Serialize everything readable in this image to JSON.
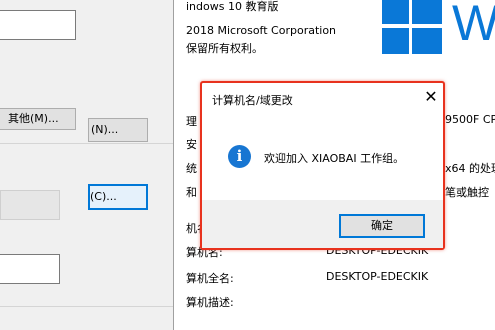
{
  "left_panel": {
    "other_button": "其他(M)...",
    "change_button_partial": "(N)...",
    "change_c_button_partial": "(C)..."
  },
  "system_info": {
    "edition_partial": "indows 10 教育版",
    "copyright": "2018 Microsoft Corporation",
    "rights": "保留所有权利。",
    "logo_letter": "W",
    "processor_label_partial": "理",
    "processor_value_partial": "9500F CP",
    "installed_label_partial": "安",
    "system_type_label_partial": "统",
    "system_type_value_partial": "x64 的处理",
    "pen_label_partial": "和",
    "pen_value_partial": "笔或触控",
    "computer_name_section_partial": "机名",
    "computer_name_label": "算机名:",
    "computer_name_value": "DESKTOP-EDECKIK",
    "full_name_label": "算机全名:",
    "full_name_value": "DESKTOP-EDECKIK",
    "description_label": "算机描述:"
  },
  "dialog": {
    "title": "计算机名/域更改",
    "close_symbol": "✕",
    "info_symbol": "i",
    "message": "欢迎加入 XIAOBAI 工作组。",
    "ok_label": "确定"
  },
  "colors": {
    "accent": "#0078d7",
    "dialog_border": "#e8321e",
    "info_icon": "#1876d2",
    "windows_logo": "#0a78d7"
  }
}
